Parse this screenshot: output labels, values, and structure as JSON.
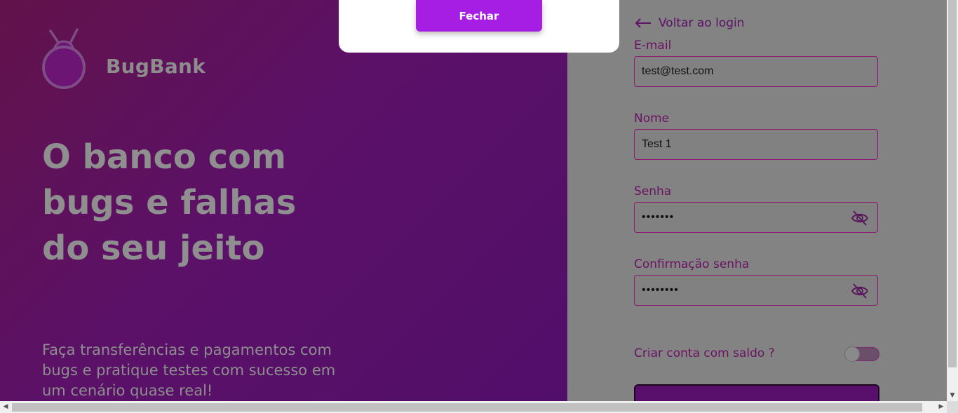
{
  "brand": {
    "name": "BugBank"
  },
  "hero": {
    "headline_lines": [
      "O banco com",
      "bugs e falhas",
      "do seu jeito"
    ],
    "subtitle_lines": [
      "Faça transferências e pagamentos com",
      "bugs e pratique testes com sucesso em",
      "um cenário quase real!"
    ]
  },
  "modal": {
    "close_label": "Fechar"
  },
  "form": {
    "back_label": "Voltar ao login",
    "email_label": "E-mail",
    "email_value": "test@test.com",
    "name_label": "Nome",
    "name_value": "Test 1",
    "password_label": "Senha",
    "password_value": "•••••••",
    "confirm_label": "Confirmação senha",
    "confirm_value": "••••••••",
    "balance_toggle_label": "Criar conta com saldo ?",
    "balance_toggle_on": false
  },
  "colors": {
    "accent": "#a61ee3",
    "label": "#6a1262",
    "hero_bg": "#5b1167",
    "overlay_gray": "#838383"
  },
  "icons": {
    "back": "arrow-left-icon",
    "password_visibility": "eye-off-icon",
    "logo": "bug-logo-icon"
  }
}
